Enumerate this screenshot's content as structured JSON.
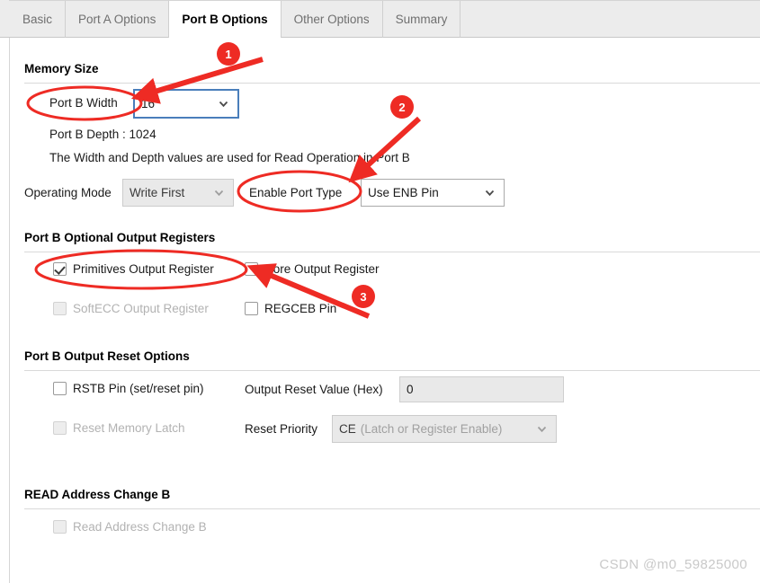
{
  "window": {
    "title": "Port B Options"
  },
  "tabs": [
    {
      "label": "Basic",
      "active": false
    },
    {
      "label": "Port A Options",
      "active": false
    },
    {
      "label": "Port B Options",
      "active": true
    },
    {
      "label": "Other Options",
      "active": false
    },
    {
      "label": "Summary",
      "active": false
    }
  ],
  "sections": {
    "memory_size": {
      "title": "Memory Size",
      "port_b_width_label": "Port B Width",
      "port_b_width_value": "16",
      "port_b_depth": "Port B Depth : 1024",
      "note": "The Width and Depth values are used for Read Operation in Port B",
      "operating_mode_label": "Operating Mode",
      "operating_mode_value": "Write First",
      "enable_port_type_label": "Enable Port Type",
      "enable_port_type_value": "Use ENB Pin"
    },
    "optional_output_registers": {
      "title": "Port B Optional Output Registers",
      "items": [
        {
          "label": "Primitives Output Register",
          "checked": true,
          "disabled": false
        },
        {
          "label": "Core Output Register",
          "checked": false,
          "disabled": false
        },
        {
          "label": "SoftECC Output Register",
          "checked": false,
          "disabled": true
        },
        {
          "label": "REGCEB Pin",
          "checked": false,
          "disabled": false
        }
      ]
    },
    "output_reset_options": {
      "title": "Port B Output Reset Options",
      "rstb_pin_label": "RSTB Pin (set/reset pin)",
      "rstb_pin_checked": false,
      "reset_memory_latch_label": "Reset Memory Latch",
      "reset_memory_latch_checked": false,
      "reset_memory_latch_disabled": true,
      "output_reset_value_label": "Output Reset Value (Hex)",
      "output_reset_value": "0",
      "reset_priority_label": "Reset Priority",
      "reset_priority_value": "CE",
      "reset_priority_value_sub": "(Latch or Register Enable)"
    },
    "read_address_change": {
      "title": "READ Address Change B",
      "checkbox_label": "Read Address Change B",
      "checked": false,
      "disabled": true
    }
  },
  "annotations": {
    "accent_color": "#ee2b24",
    "markers": [
      {
        "number": "1"
      },
      {
        "number": "2"
      },
      {
        "number": "3"
      }
    ]
  },
  "watermark": "CSDN @m0_59825000"
}
